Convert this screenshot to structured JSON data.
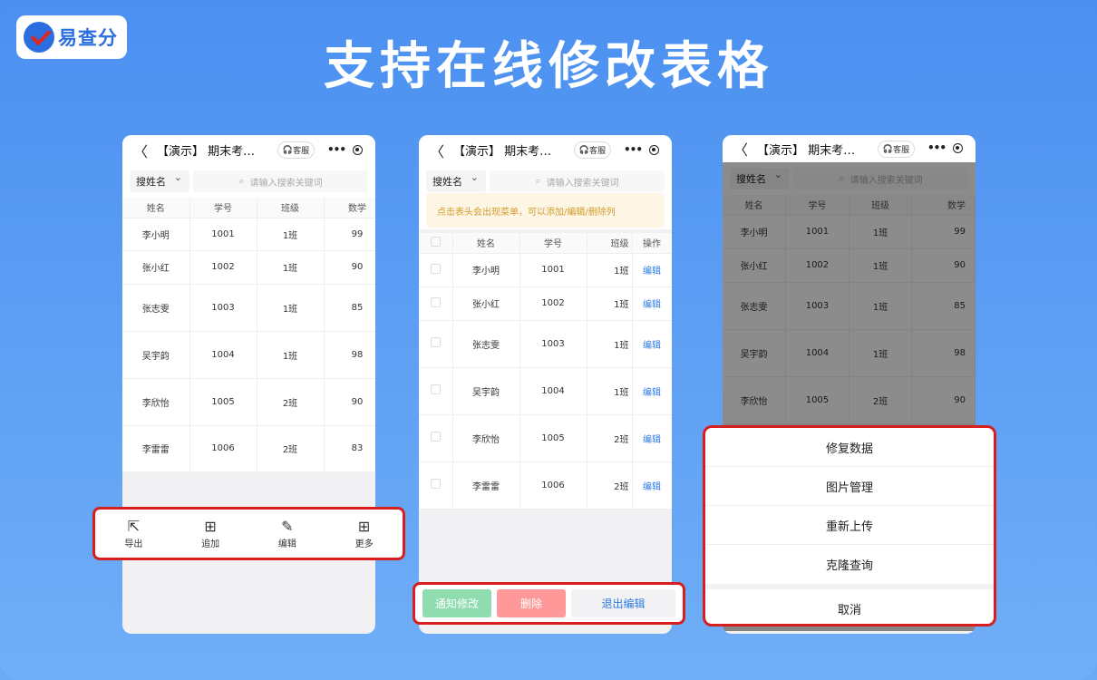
{
  "brand": {
    "logo_text": "易查分"
  },
  "headline": "支持在线修改表格",
  "nav": {
    "back": "〈",
    "title": "【演示】 期末考…",
    "service": "客服",
    "more": "•••"
  },
  "search": {
    "select": "搜姓名",
    "placeholder": "请输入搜索关键词"
  },
  "hint": "点击表头会出现菜单，可以添加/编辑/删除列",
  "table": {
    "headers": [
      "姓名",
      "学号",
      "班级",
      "数学"
    ],
    "edit_headers": [
      "姓名",
      "学号",
      "班级",
      "操作"
    ],
    "rows": [
      [
        "李小明",
        "1001",
        "1班",
        "99"
      ],
      [
        "张小红",
        "1002",
        "1班",
        "90"
      ],
      [
        "张志雯",
        "1003",
        "1班",
        "85"
      ],
      [
        "吴宇韵",
        "1004",
        "1班",
        "98"
      ],
      [
        "李欣怡",
        "1005",
        "2班",
        "90"
      ],
      [
        "李雷雷",
        "1006",
        "2班",
        "83"
      ]
    ],
    "edit_label": "编辑"
  },
  "toolbar": {
    "export": "导出",
    "add": "追加",
    "edit": "编辑",
    "more": "更多"
  },
  "actions": {
    "notify": "通知修改",
    "delete": "删除",
    "exit": "退出编辑"
  },
  "sheet": {
    "items": [
      "修复数据",
      "图片管理",
      "重新上传",
      "克隆查询"
    ],
    "cancel": "取消"
  }
}
